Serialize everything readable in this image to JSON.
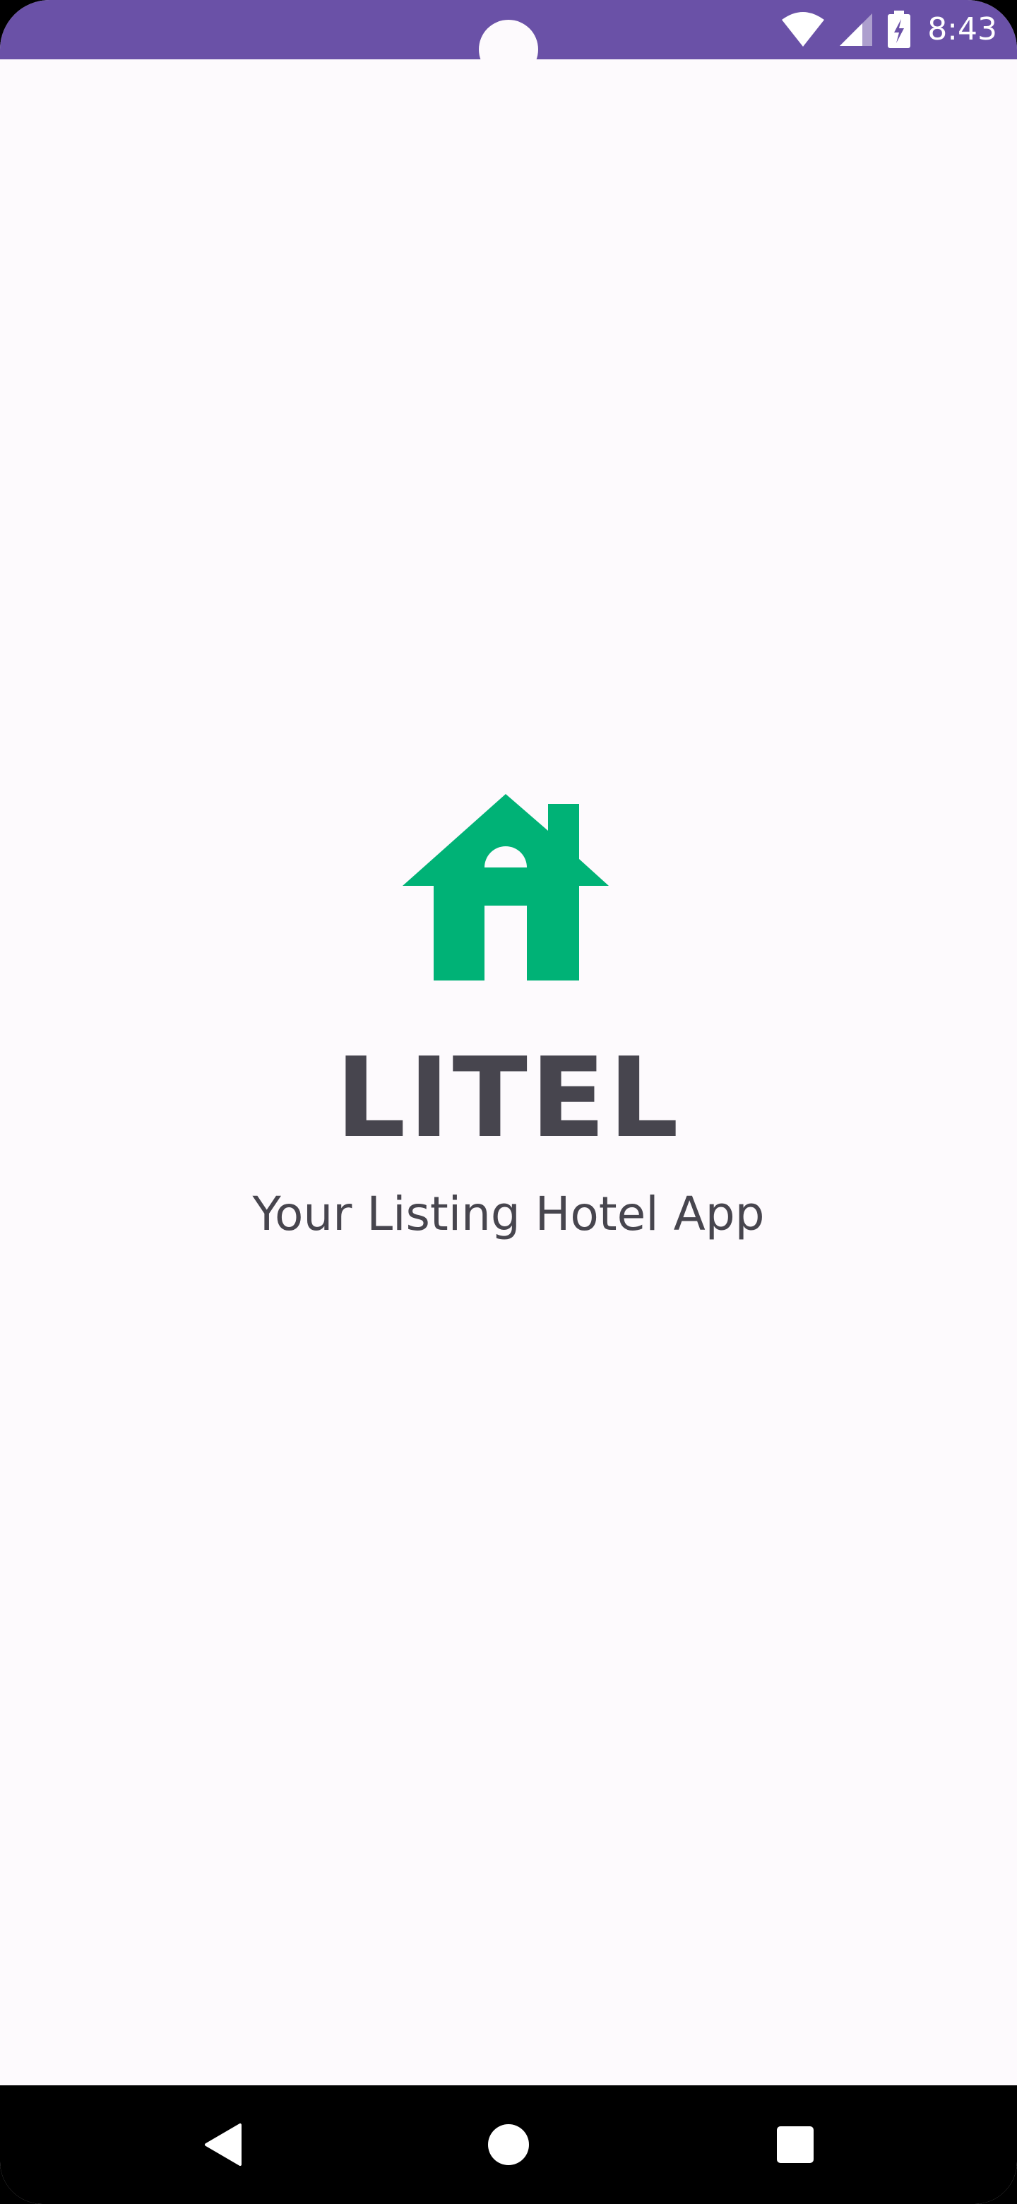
{
  "status_bar": {
    "time": "8:43",
    "background_color": "#6A51A7",
    "icons": [
      "wifi-icon",
      "cellular-signal-icon",
      "battery-charging-icon"
    ]
  },
  "splash": {
    "logo_icon": "house-icon",
    "logo_color": "#00B276",
    "app_name": "LITEL",
    "tagline": "Your Listing Hotel App",
    "text_color": "#47454E",
    "background_color": "#FDFAFD"
  },
  "navigation_bar": {
    "buttons": [
      "back-button",
      "home-button",
      "recents-button"
    ]
  }
}
